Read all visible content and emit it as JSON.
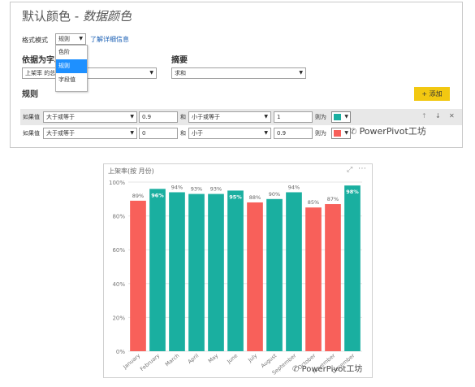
{
  "dialog": {
    "title": "默认颜色",
    "title_sep": " - ",
    "subtitle": "数据颜色",
    "format_mode_label": "格式模式",
    "format_mode_value": "规则",
    "learn_more": "了解详细信息",
    "menu_items": [
      "色阶",
      "规则",
      "字段值"
    ],
    "based_on_label": "依据为字段",
    "based_on_value": "上架率 的总",
    "summary_label": "摘要",
    "summary_value": "求和",
    "rules_label": "规则",
    "add_button": "+ 添加",
    "rules": [
      {
        "if": "如果值",
        "op1": "大于或等于",
        "v1": "0.9",
        "and": "和",
        "op2": "小于或等于",
        "v2": "1",
        "then": "则为",
        "color": "#1aafa0"
      },
      {
        "if": "如果值",
        "op1": "大于或等于",
        "v1": "0",
        "and": "和",
        "op2": "小于",
        "v2": "0.9",
        "then": "则为",
        "color": "#f8605a"
      }
    ],
    "row_icons": [
      "↑",
      "↓",
      "✕"
    ]
  },
  "watermark_top": "PowerPivot工坊",
  "watermark_bottom": "PowerPivot工坊",
  "chart_data": {
    "type": "bar",
    "title": "上架率(按 月份)",
    "categories": [
      "January",
      "February",
      "March",
      "April",
      "May",
      "June",
      "July",
      "August",
      "September",
      "October",
      "November",
      "December"
    ],
    "values": [
      89,
      96,
      94,
      93,
      93,
      95,
      88,
      90,
      94,
      85,
      87,
      98
    ],
    "data_labels": [
      "89%",
      "96%",
      "94%",
      "93%",
      "93%",
      "95%",
      "88%",
      "90%",
      "94%",
      "85%",
      "87%",
      "98%"
    ],
    "ylim": [
      0,
      100
    ],
    "yticks": [
      "0%",
      "20%",
      "40%",
      "60%",
      "80%",
      "100%"
    ],
    "colors": {
      "high": "#1aafa0",
      "low": "#f8605a"
    },
    "grid": true
  }
}
